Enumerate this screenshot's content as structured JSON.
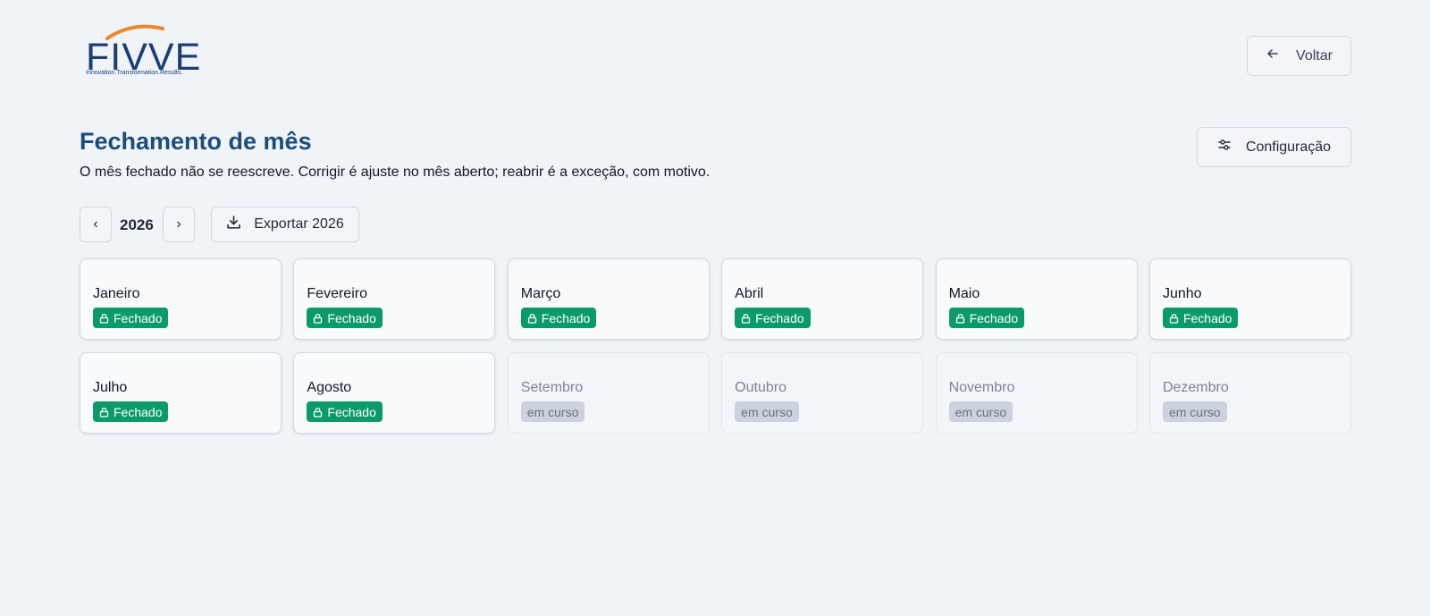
{
  "brand": {
    "name": "FIVVE",
    "tagline": "Innovation.Transformation.Results.",
    "colors": {
      "text": "#1c3f73",
      "arc": "#e8892b"
    }
  },
  "header": {
    "back_label": "Voltar",
    "back_icon": "arrow-left-icon"
  },
  "page": {
    "title": "Fechamento de mês",
    "subtitle": "O mês fechado não se reescreve. Corrigir é ajuste no mês aberto; reabrir é a exceção, com motivo.",
    "config_label": "Configuração",
    "config_icon": "sliders-icon"
  },
  "toolbar": {
    "prev_label": "‹",
    "year": "2026",
    "next_label": "›",
    "export_label": "Exportar 2026",
    "export_icon": "download-icon"
  },
  "months": [
    {
      "name": "Janeiro",
      "status": "Fechado",
      "closed": true
    },
    {
      "name": "Fevereiro",
      "status": "Fechado",
      "closed": true
    },
    {
      "name": "Março",
      "status": "Fechado",
      "closed": true
    },
    {
      "name": "Abril",
      "status": "Fechado",
      "closed": true
    },
    {
      "name": "Maio",
      "status": "Fechado",
      "closed": true
    },
    {
      "name": "Junho",
      "status": "Fechado",
      "closed": true
    },
    {
      "name": "Julho",
      "status": "Fechado",
      "closed": true
    },
    {
      "name": "Agosto",
      "status": "Fechado",
      "closed": true
    },
    {
      "name": "Setembro",
      "status": "em curso",
      "closed": false
    },
    {
      "name": "Outubro",
      "status": "em curso",
      "closed": false
    },
    {
      "name": "Novembro",
      "status": "em curso",
      "closed": false
    },
    {
      "name": "Dezembro",
      "status": "em curso",
      "closed": false
    }
  ],
  "colors": {
    "title": "#1c4d7a",
    "closed_badge": "#0c9a6c",
    "running_badge": "#cbd2dd"
  }
}
